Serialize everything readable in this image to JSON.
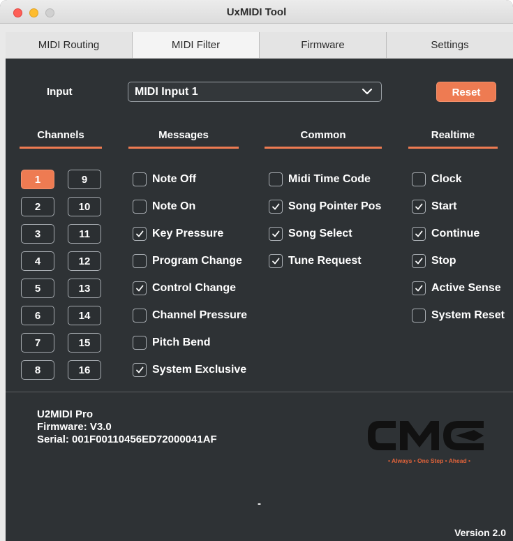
{
  "window": {
    "title": "UxMIDI Tool"
  },
  "tabs": [
    {
      "label": "MIDI Routing",
      "active": false
    },
    {
      "label": "MIDI Filter",
      "active": true
    },
    {
      "label": "Firmware",
      "active": false
    },
    {
      "label": "Settings",
      "active": false
    }
  ],
  "input": {
    "label": "Input",
    "selected": "MIDI Input 1",
    "reset_label": "Reset"
  },
  "columns": {
    "channels": "Channels",
    "messages": "Messages",
    "common": "Common",
    "realtime": "Realtime"
  },
  "channels": [
    {
      "label": "1",
      "selected": true
    },
    {
      "label": "9",
      "selected": false
    },
    {
      "label": "2",
      "selected": false
    },
    {
      "label": "10",
      "selected": false
    },
    {
      "label": "3",
      "selected": false
    },
    {
      "label": "11",
      "selected": false
    },
    {
      "label": "4",
      "selected": false
    },
    {
      "label": "12",
      "selected": false
    },
    {
      "label": "5",
      "selected": false
    },
    {
      "label": "13",
      "selected": false
    },
    {
      "label": "6",
      "selected": false
    },
    {
      "label": "14",
      "selected": false
    },
    {
      "label": "7",
      "selected": false
    },
    {
      "label": "15",
      "selected": false
    },
    {
      "label": "8",
      "selected": false
    },
    {
      "label": "16",
      "selected": false
    }
  ],
  "messages": [
    {
      "label": "Note Off",
      "checked": false
    },
    {
      "label": "Note On",
      "checked": false
    },
    {
      "label": "Key Pressure",
      "checked": true
    },
    {
      "label": "Program Change",
      "checked": false
    },
    {
      "label": "Control Change",
      "checked": true
    },
    {
      "label": "Channel Pressure",
      "checked": false
    },
    {
      "label": "Pitch Bend",
      "checked": false
    },
    {
      "label": "System Exclusive",
      "checked": true
    }
  ],
  "common": [
    {
      "label": "Midi Time Code",
      "checked": false
    },
    {
      "label": "Song Pointer Pos",
      "checked": true
    },
    {
      "label": "Song Select",
      "checked": true
    },
    {
      "label": "Tune Request",
      "checked": true
    }
  ],
  "realtime": [
    {
      "label": "Clock",
      "checked": false
    },
    {
      "label": "Start",
      "checked": true
    },
    {
      "label": "Continue",
      "checked": true
    },
    {
      "label": "Stop",
      "checked": true
    },
    {
      "label": "Active Sense",
      "checked": true
    },
    {
      "label": "System Reset",
      "checked": false
    }
  ],
  "device": {
    "name": "U2MIDI Pro",
    "firmware": "Firmware: V3.0",
    "serial": "Serial: 001F00110456ED72000041AF"
  },
  "logo": {
    "text": "CME",
    "tagline": "• Always • One Step • Ahead •"
  },
  "status": "-",
  "version": "Version 2.0",
  "colors": {
    "accent": "#ee7b52",
    "background": "#2e3235"
  }
}
